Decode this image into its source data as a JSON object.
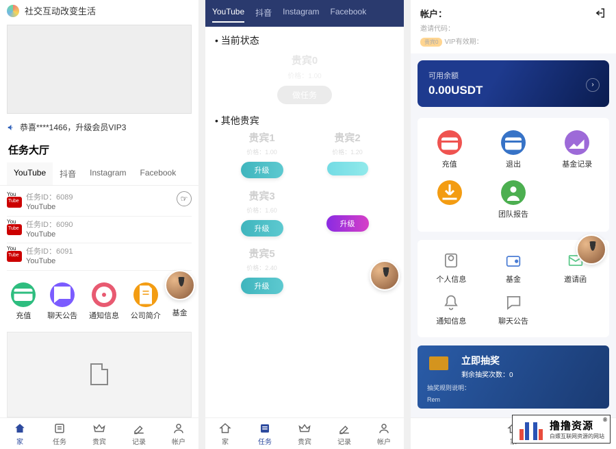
{
  "left": {
    "slogan": "社交互动改变生活",
    "announce": "恭喜****1466，升级会员VIP3",
    "section_title": "任务大厅",
    "tabs": [
      "YouTube",
      "抖音",
      "Instagram",
      "Facebook"
    ],
    "tasks": [
      {
        "id": "任务ID：6089",
        "name": "YouTube"
      },
      {
        "id": "任务ID：6090",
        "name": "YouTube"
      },
      {
        "id": "任务ID：6091",
        "name": "YouTube"
      }
    ],
    "actions": [
      {
        "label": "充值",
        "icon": "card"
      },
      {
        "label": "聊天公告",
        "icon": "speech"
      },
      {
        "label": "通知信息",
        "icon": "bell"
      },
      {
        "label": "公司简介",
        "icon": "file"
      },
      {
        "label": "基金",
        "icon": "fund"
      }
    ]
  },
  "mid": {
    "tabs": [
      "YouTube",
      "抖音",
      "Instagram",
      "Facebook"
    ],
    "current_status": "当前状态",
    "vip0": {
      "name": "贵宾0",
      "sub": "价格：1.00",
      "btn": "做任务"
    },
    "other_title": "其他贵宾",
    "others": [
      {
        "name": "贵宾1",
        "sub": "价格：1.00",
        "btn": "升级",
        "grad": "grad-blue"
      },
      {
        "name": "贵宾2",
        "sub": "价格：1.20",
        "btn": "",
        "grad": "grad-teal"
      },
      {
        "name": "贵宾3",
        "sub": "价格：1.60",
        "btn": "升级",
        "grad": "grad-blue"
      },
      {
        "name": "",
        "sub": "",
        "btn": "升级",
        "grad": "grad-purple"
      },
      {
        "name": "贵宾5",
        "sub": "价格：2.40",
        "btn": "升级",
        "grad": "grad-blue"
      }
    ]
  },
  "right": {
    "account_label": "帐户：",
    "invite_label": "邀请代码：",
    "badge": "贵宾0",
    "vip_expire": "VIP有效期：",
    "balance_label": "可用余额",
    "balance_amount": "0.00USDT",
    "grid1": [
      {
        "label": "充值",
        "bg": "bg-red",
        "glyph": "card"
      },
      {
        "label": "退出",
        "bg": "bg-blue",
        "glyph": "exit"
      },
      {
        "label": "基金记录",
        "bg": "bg-purple",
        "glyph": "chart"
      },
      {
        "label": "",
        "bg": "bg-orange",
        "glyph": "down"
      },
      {
        "label": "团队报告",
        "bg": "bg-green",
        "glyph": "team"
      }
    ],
    "grid2": [
      {
        "label": "个人信息",
        "cls": ""
      },
      {
        "label": "基金",
        "cls": "card"
      },
      {
        "label": "邀请函",
        "cls": "mail"
      },
      {
        "label": "通知信息",
        "cls": ""
      },
      {
        "label": "聊天公告",
        "cls": ""
      }
    ],
    "lottery": {
      "title": "立即抽奖",
      "sub": "剩余抽奖次数：0",
      "rule": "抽奖规则说明：",
      "rem": "Rem"
    }
  },
  "nav": [
    {
      "label": "家",
      "icon": "home"
    },
    {
      "label": "任务",
      "icon": "list"
    },
    {
      "label": "贵宾",
      "icon": "crown"
    },
    {
      "label": "记录",
      "icon": "edit"
    },
    {
      "label": "帐户",
      "icon": "user"
    }
  ],
  "watermark": {
    "main": "撸撸资源",
    "sub": "白嫖互联网资源的网站"
  }
}
